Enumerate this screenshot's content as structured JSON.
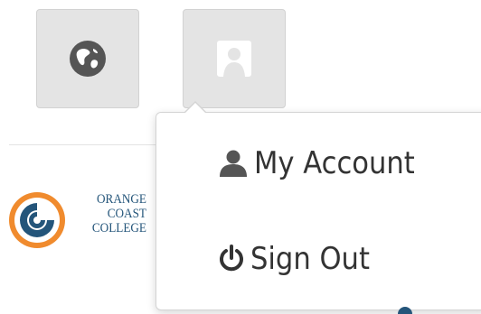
{
  "header": {
    "language_button": {
      "icon": "globe-icon"
    },
    "profile_button": {
      "icon": "user-placeholder-icon"
    }
  },
  "logo": {
    "line1": "ORANGE",
    "line2": "COAST",
    "line3": "COLLEGE",
    "colors": {
      "orange": "#f08b2e",
      "blue": "#24557a"
    }
  },
  "dropdown": {
    "items": [
      {
        "label": "My Account",
        "icon": "user-icon"
      },
      {
        "label": "Sign Out",
        "icon": "power-icon"
      }
    ]
  },
  "colors": {
    "button_bg": "#e4e4e4",
    "icon_gray": "#555555",
    "text": "#333333",
    "border": "#d4d4d4"
  }
}
